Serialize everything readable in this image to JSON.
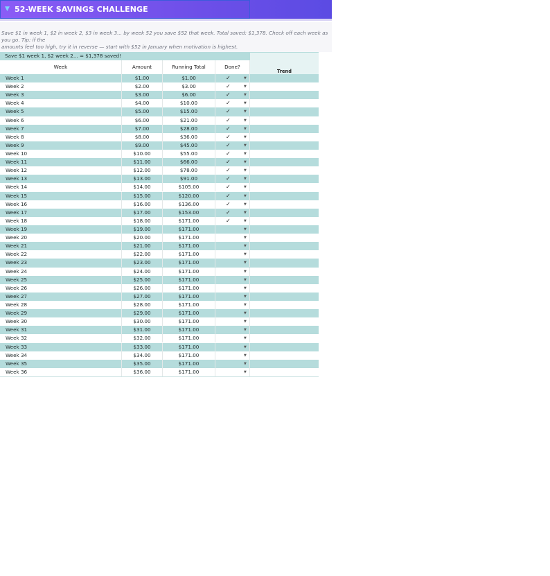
{
  "title": "52-WEEK SAVINGS CHALLENGE",
  "title_icon": "funnel-icon",
  "intro": "Save $1 in week 1, $2 in week 2, $3 in week 3... by week 52 you save $52 that week. Total saved: $1,378. Check off each week as you go. Tip: if the\namounts feel too high, try it in reverse — start with $52 in January when motivation is highest.",
  "summary": "Save $1 week 1, $2 week 2... = $1,378 saved!",
  "columns": {
    "week": "Week",
    "amount": "Amount",
    "running_total": "Running Total",
    "done": "Done?",
    "trend": "Trend"
  },
  "colors": {
    "banner_start": "#8b5cf6",
    "banner_end": "#5b4be3",
    "row_alt": "#b5dcdc",
    "trend_header_bg": "#e6f3f3"
  },
  "rows": [
    {
      "week": "Week 1",
      "amount": "$1.00",
      "total": "$1.00",
      "done": "✓"
    },
    {
      "week": "Week 2",
      "amount": "$2.00",
      "total": "$3.00",
      "done": "✓"
    },
    {
      "week": "Week 3",
      "amount": "$3.00",
      "total": "$6.00",
      "done": "✓"
    },
    {
      "week": "Week 4",
      "amount": "$4.00",
      "total": "$10.00",
      "done": "✓"
    },
    {
      "week": "Week 5",
      "amount": "$5.00",
      "total": "$15.00",
      "done": "✓"
    },
    {
      "week": "Week 6",
      "amount": "$6.00",
      "total": "$21.00",
      "done": "✓"
    },
    {
      "week": "Week 7",
      "amount": "$7.00",
      "total": "$28.00",
      "done": "✓"
    },
    {
      "week": "Week 8",
      "amount": "$8.00",
      "total": "$36.00",
      "done": "✓"
    },
    {
      "week": "Week 9",
      "amount": "$9.00",
      "total": "$45.00",
      "done": "✓"
    },
    {
      "week": "Week 10",
      "amount": "$10.00",
      "total": "$55.00",
      "done": "✓"
    },
    {
      "week": "Week 11",
      "amount": "$11.00",
      "total": "$66.00",
      "done": "✓"
    },
    {
      "week": "Week 12",
      "amount": "$12.00",
      "total": "$78.00",
      "done": "✓"
    },
    {
      "week": "Week 13",
      "amount": "$13.00",
      "total": "$91.00",
      "done": "✓"
    },
    {
      "week": "Week 14",
      "amount": "$14.00",
      "total": "$105.00",
      "done": "✓"
    },
    {
      "week": "Week 15",
      "amount": "$15.00",
      "total": "$120.00",
      "done": "✓"
    },
    {
      "week": "Week 16",
      "amount": "$16.00",
      "total": "$136.00",
      "done": "✓"
    },
    {
      "week": "Week 17",
      "amount": "$17.00",
      "total": "$153.00",
      "done": "✓"
    },
    {
      "week": "Week 18",
      "amount": "$18.00",
      "total": "$171.00",
      "done": "✓"
    },
    {
      "week": "Week 19",
      "amount": "$19.00",
      "total": "$171.00",
      "done": ""
    },
    {
      "week": "Week 20",
      "amount": "$20.00",
      "total": "$171.00",
      "done": ""
    },
    {
      "week": "Week 21",
      "amount": "$21.00",
      "total": "$171.00",
      "done": ""
    },
    {
      "week": "Week 22",
      "amount": "$22.00",
      "total": "$171.00",
      "done": ""
    },
    {
      "week": "Week 23",
      "amount": "$23.00",
      "total": "$171.00",
      "done": ""
    },
    {
      "week": "Week 24",
      "amount": "$24.00",
      "total": "$171.00",
      "done": ""
    },
    {
      "week": "Week 25",
      "amount": "$25.00",
      "total": "$171.00",
      "done": ""
    },
    {
      "week": "Week 26",
      "amount": "$26.00",
      "total": "$171.00",
      "done": ""
    },
    {
      "week": "Week 27",
      "amount": "$27.00",
      "total": "$171.00",
      "done": ""
    },
    {
      "week": "Week 28",
      "amount": "$28.00",
      "total": "$171.00",
      "done": ""
    },
    {
      "week": "Week 29",
      "amount": "$29.00",
      "total": "$171.00",
      "done": ""
    },
    {
      "week": "Week 30",
      "amount": "$30.00",
      "total": "$171.00",
      "done": ""
    },
    {
      "week": "Week 31",
      "amount": "$31.00",
      "total": "$171.00",
      "done": ""
    },
    {
      "week": "Week 32",
      "amount": "$32.00",
      "total": "$171.00",
      "done": ""
    },
    {
      "week": "Week 33",
      "amount": "$33.00",
      "total": "$171.00",
      "done": ""
    },
    {
      "week": "Week 34",
      "amount": "$34.00",
      "total": "$171.00",
      "done": ""
    },
    {
      "week": "Week 35",
      "amount": "$35.00",
      "total": "$171.00",
      "done": ""
    },
    {
      "week": "Week 36",
      "amount": "$36.00",
      "total": "$171.00",
      "done": ""
    }
  ]
}
